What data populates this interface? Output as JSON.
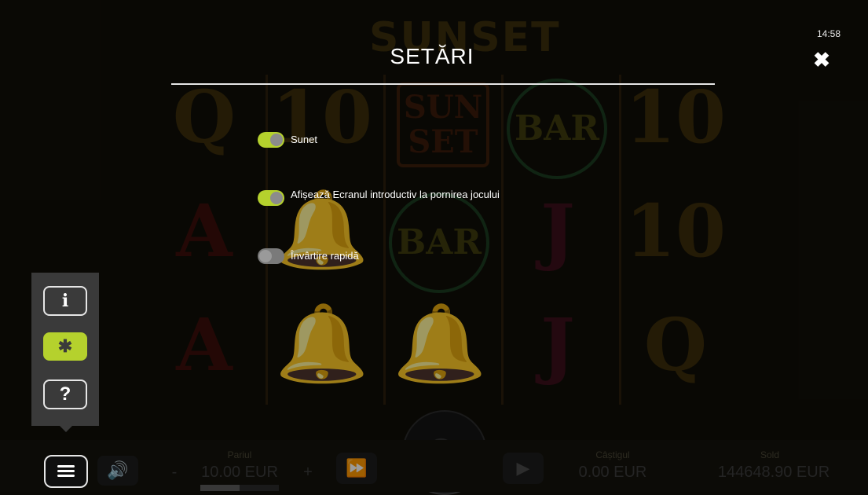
{
  "game": {
    "logo_text": "SUNSET",
    "reels": [
      [
        "Q",
        "A",
        "A"
      ],
      [
        "10",
        "bell",
        "bell"
      ],
      [
        "SUN SET",
        "BAR",
        "bell"
      ],
      [
        "BAR",
        "J",
        "J"
      ],
      [
        "10",
        "10",
        "Q"
      ]
    ]
  },
  "status": {
    "clock": "14:58"
  },
  "settings_dialog": {
    "title": "SETĂRI",
    "options": [
      {
        "label": "Sunet",
        "enabled": true
      },
      {
        "label": "Afișează Ecranul introductiv la pornirea jocului",
        "enabled": true
      },
      {
        "label": "Învârtire rapidă",
        "enabled": false
      }
    ]
  },
  "side_menu": {
    "info_glyph": "i",
    "settings_glyph": "✱",
    "help_glyph": "?"
  },
  "bottom_bar": {
    "bet_label": "Pariul",
    "bet_value": "10.00 EUR",
    "minus_label": "-",
    "plus_label": "+",
    "win_label": "Câștigul",
    "win_value": "0.00 EUR",
    "balance_label": "Sold",
    "balance_value": "144648.90 EUR",
    "bet_level_fraction": 0.5
  },
  "icons": {
    "close": "close-icon",
    "menu": "hamburger-menu-icon",
    "sound": "speaker-icon",
    "fast_forward": "fast-forward-icon",
    "spin": "spin-refresh-icon",
    "autoplay": "play-icon"
  },
  "colors": {
    "accent": "#b5d12d",
    "panel": "#3a3a3a"
  }
}
